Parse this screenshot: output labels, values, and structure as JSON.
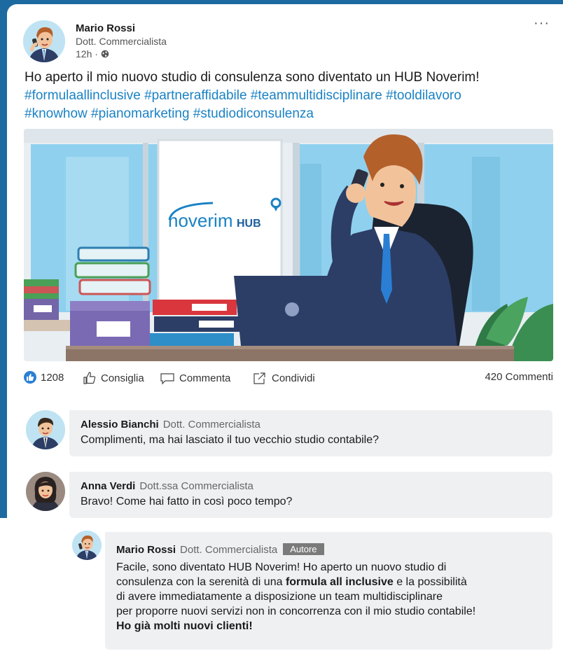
{
  "post": {
    "author_name": "Mario Rossi",
    "author_role": "Dott. Commercialista",
    "time": "12h ·",
    "more_label": "···",
    "text": "Ho aperto il mio nuovo studio di consulenza sono diventato un HUB Noverim!",
    "hashtags_line1": "#formulaallinclusive #partneraffidabile #teammultidisciplinare #tooldilavoro",
    "hashtags_line2": "#knowhow #pianomarketing #studiodiconsulenza",
    "image_logo_text": "noverim",
    "image_logo_hub": "HUB"
  },
  "actions": {
    "like_count": "1208",
    "like_label": "Consiglia",
    "comment_label": "Commenta",
    "share_label": "Condividi",
    "comments_total": "420 Commenti"
  },
  "comments": [
    {
      "name": "Alessio Bianchi",
      "role": "Dott. Commercialista",
      "text": "Complimenti, ma hai lasciato il tuo vecchio studio contabile?"
    },
    {
      "name": "Anna Verdi",
      "role": "Dott.ssa Commercialista",
      "text": "Bravo! Come hai fatto in così poco tempo?"
    }
  ],
  "reply": {
    "name": "Mario Rossi",
    "role": "Dott. Commercialista",
    "badge": "Autore",
    "line1": "Facile, sono diventato HUB Noverim! Ho aperto un nuovo studio di",
    "line2_pre": "consulenza con la serenità di una ",
    "line2_bold": "formula all inclusive",
    "line2_post": " e la possibilità",
    "line3": "di avere immediatamente a disposizione un team multidisciplinare",
    "line4": "per proporre nuovi servizi non in concorrenza con il mio studio contabile!",
    "line5_bold": "Ho già molti nuovi clienti!"
  },
  "colors": {
    "frame_blue": "#1d6aa0",
    "hashtag_blue": "#1a82c4",
    "like_blue": "#2a7fd4",
    "comment_bg": "#eef0f2",
    "badge_gray": "#7a7a7a"
  }
}
